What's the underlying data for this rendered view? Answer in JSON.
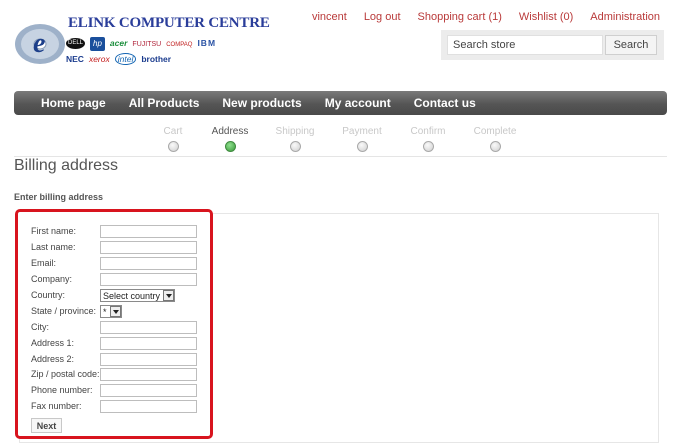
{
  "brand": {
    "title": "ELINK COMPUTER CENTRE",
    "logos_row1": [
      "DELL",
      "hp",
      "acer",
      "FUJITSU",
      "COMPAQ",
      "IBM"
    ],
    "logos_row2": [
      "NEC",
      "xerox",
      "intel",
      "brother"
    ]
  },
  "header_links": [
    "vincent",
    "Log out",
    "Shopping cart (1)",
    "Wishlist (0)",
    "Administration"
  ],
  "search": {
    "placeholder": "Search store",
    "button": "Search"
  },
  "nav": [
    "Home page",
    "All Products",
    "New products",
    "My account",
    "Contact us"
  ],
  "steps": [
    {
      "label": "Cart",
      "active": false
    },
    {
      "label": "Address",
      "active": true
    },
    {
      "label": "Shipping",
      "active": false
    },
    {
      "label": "Payment",
      "active": false
    },
    {
      "label": "Confirm",
      "active": false
    },
    {
      "label": "Complete",
      "active": false
    }
  ],
  "page": {
    "title": "Billing address",
    "subtitle": "Enter billing address"
  },
  "form": {
    "first_name": "First name:",
    "last_name": "Last name:",
    "email": "Email:",
    "company": "Company:",
    "country": "Country:",
    "country_value": "Select country",
    "state": "State / province:",
    "state_value": "*",
    "city": "City:",
    "address1": "Address 1:",
    "address2": "Address 2:",
    "zip": "Zip / postal code:",
    "phone": "Phone number:",
    "fax": "Fax number:",
    "next": "Next"
  },
  "colors": {
    "accent": "#b93a3a",
    "highlight_border": "#d8141e",
    "nav_bg": "#555555",
    "active_step": "#3a9a3a"
  }
}
